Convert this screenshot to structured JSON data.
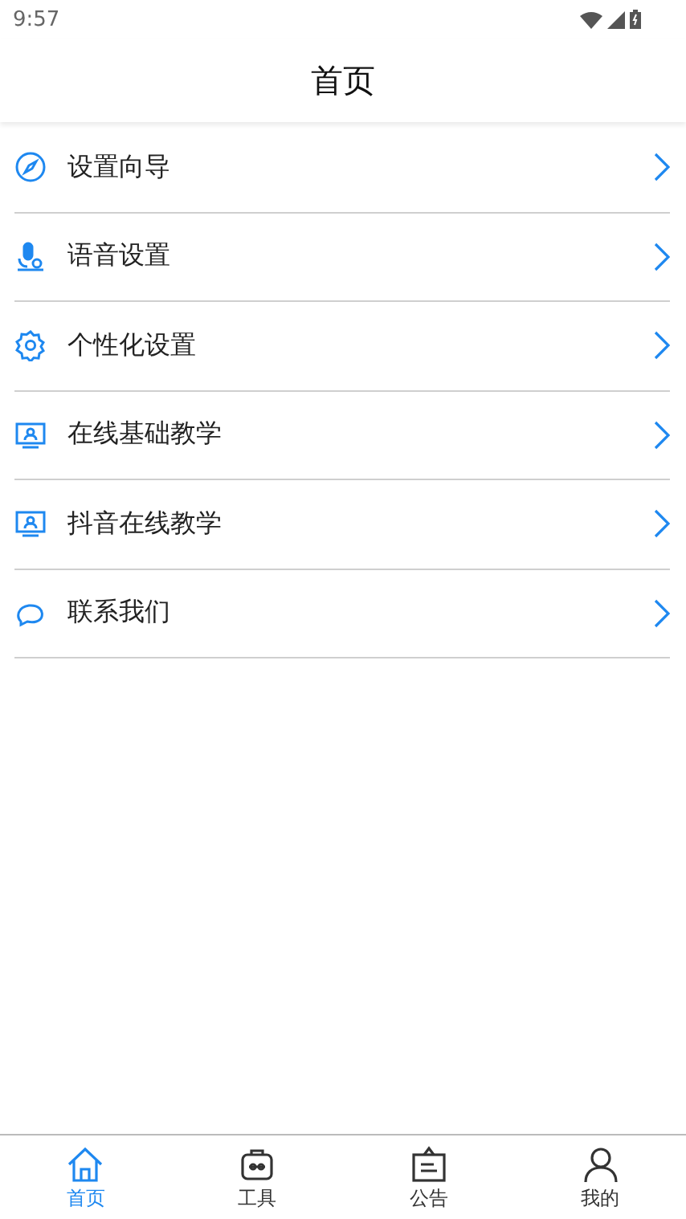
{
  "status_bar": {
    "time": "9:57"
  },
  "header": {
    "title": "首页"
  },
  "menu": [
    {
      "label": "设置向导",
      "kind": "compass"
    },
    {
      "label": "语音设置",
      "kind": "voice"
    },
    {
      "label": "个性化设置",
      "kind": "gear"
    },
    {
      "label": "在线基础教学",
      "kind": "screen"
    },
    {
      "label": "抖音在线教学",
      "kind": "screen"
    },
    {
      "label": "联系我们",
      "kind": "chat"
    }
  ],
  "tabs": [
    {
      "label": "首页",
      "kind": "home",
      "selected": true
    },
    {
      "label": "工具",
      "kind": "toolbox",
      "selected": false
    },
    {
      "label": "公告",
      "kind": "notice",
      "selected": false
    },
    {
      "label": "我的",
      "kind": "person",
      "selected": false
    }
  ]
}
